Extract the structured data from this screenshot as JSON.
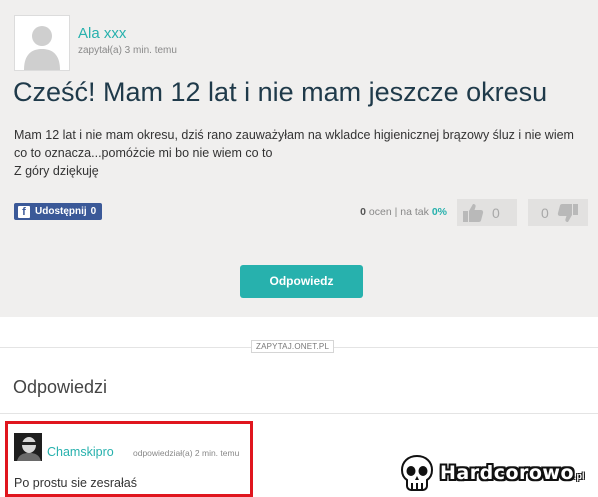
{
  "question": {
    "author": {
      "name": "Ala xxx",
      "meta": "zapytał(a) 3 min. temu"
    },
    "title": "Cześć! Mam 12 lat i nie mam jeszcze okresu",
    "body_lines": [
      "Mam 12 lat i nie mam okresu, dziś rano zauważyłam na wkladce higienicznej brązowy śluz i nie wiem co to oznacza...pomóżcie mi bo nie wiem co to",
      "Z góry dziękuję"
    ],
    "share": {
      "icon": "facebook-icon",
      "label": "Udostępnij",
      "count": "0"
    },
    "stats": {
      "ratings_count": "0",
      "ratings_label": "ocen",
      "yes_label": "na tak",
      "yes_percent": "0%"
    },
    "votes": {
      "up_icon": "thumbs-up-icon",
      "up_count": "0",
      "down_icon": "thumbs-down-icon",
      "down_count": "0"
    },
    "answer_button_label": "Odpowiedz"
  },
  "source_label": "ZAPYTAJ.ONET.PL",
  "answers": {
    "heading": "Odpowiedzi",
    "items": [
      {
        "author": "Chamskipro",
        "meta": "odpowiedział(a) 2 min. temu",
        "text": "Po prostu sie zesrałaś"
      }
    ]
  },
  "watermark": {
    "text": "Hardcorowo",
    "tld": ".pl",
    "icon": "skull-icon"
  },
  "colors": {
    "accent": "#27b1ad",
    "title": "#1f3a4a",
    "highlight_border": "#e0161e",
    "facebook": "#3b5998",
    "question_bg": "#f0efee"
  }
}
